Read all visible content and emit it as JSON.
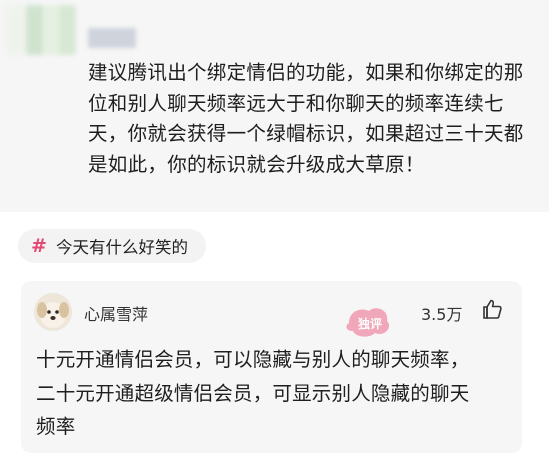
{
  "post": {
    "text": "建议腾讯出个绑定情侣的功能，如果和你绑定的那位和别人聊天频率远大于和你聊天的频率连续七天，你就会获得一个绿帽标识，如果超过三十天都是如此，你的标识就会升级成大草原！"
  },
  "topic": {
    "icon": "hash-icon",
    "label": "今天有什么好笑的"
  },
  "comment": {
    "user_name": "心属雪萍",
    "likes": "3.5万",
    "lines": [
      "十元开通情侣会员，可以隐藏与别人的聊天频率，",
      "二十元开通超级情侣会员，可显示别人隐藏的聊天",
      "频率"
    ]
  },
  "colors": {
    "accent": "#e24a76",
    "card_bg": "#f6f6f6"
  }
}
